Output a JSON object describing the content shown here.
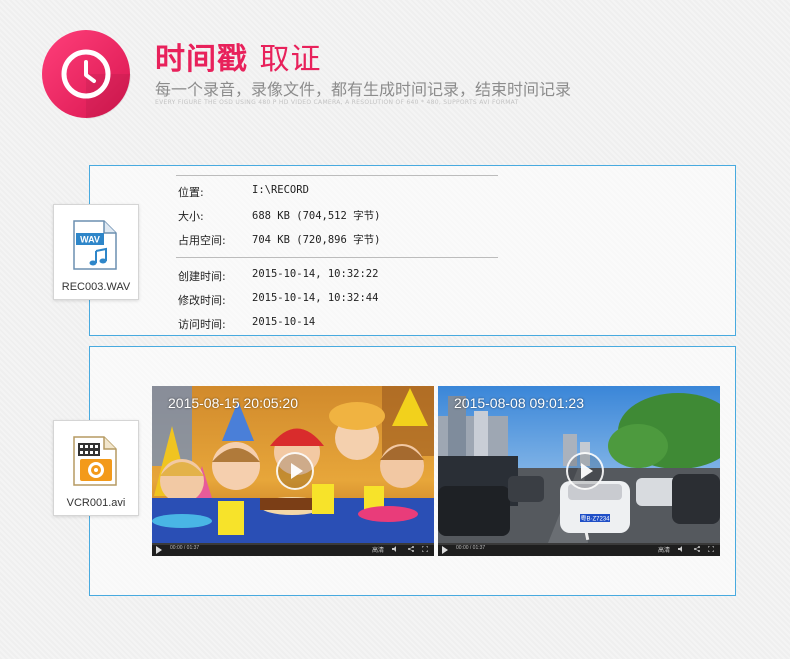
{
  "header": {
    "title_bold": "时间戳",
    "title_light": "取证",
    "subtitle": "每一个录音，录像文件，都有生成时间记录，结束时间记录",
    "english_line": "EVERY FIGURE THE OSD USING 480 P HD VIDEO CAMERA, A RESOLUTION OF 640 * 480, SUPPORTS AVI FORMAT",
    "accent_color": "#e8215b"
  },
  "audio_file": {
    "icon": "wav-file-icon",
    "badge": "WAV",
    "name": "REC003.WAV",
    "properties": [
      {
        "label": "位置:",
        "value": "I:\\RECORD"
      },
      {
        "label": "大小:",
        "value": "688 KB (704,512 字节)"
      },
      {
        "label": "占用空间:",
        "value": "704 KB (720,896 字节)"
      },
      {
        "label": "创建时间:",
        "value": "2015-10-14, 10:32:22"
      },
      {
        "label": "修改时间:",
        "value": "2015-10-14, 10:32:44"
      },
      {
        "label": "访问时间:",
        "value": "2015-10-14"
      }
    ]
  },
  "video_file": {
    "icon": "video-file-icon",
    "name": "VCR001.avi",
    "videos": [
      {
        "stamp": "2015-08-15    20:05:20",
        "time": "00:00 / 01:37",
        "quality": "高清"
      },
      {
        "stamp": "2015-08-08    09:01:23",
        "time": "00:00 / 01:37",
        "quality": "高清",
        "plate": "粤B·Z7234"
      }
    ]
  },
  "colors": {
    "frame_border": "#48aadf"
  }
}
